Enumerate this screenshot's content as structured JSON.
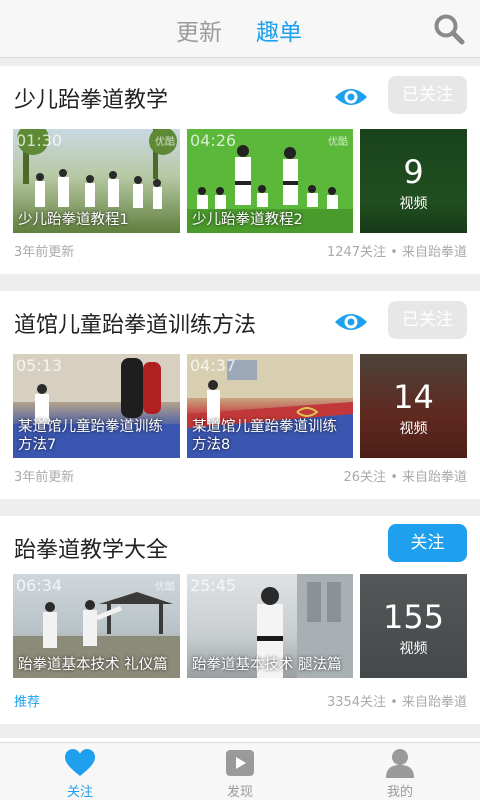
{
  "header": {
    "tabs": [
      {
        "label": "更新"
      },
      {
        "label": "趣单"
      }
    ]
  },
  "colors": {
    "accent": "#1ea0ee",
    "followed_bg": "#e7e7e7",
    "muted_text": "#aaaaaa"
  },
  "lists": [
    {
      "title": "少儿跆拳道教学",
      "button": "已关注",
      "videos": [
        {
          "duration": "01:30",
          "title": "少儿跆拳道教程1",
          "watermark": "优酷"
        },
        {
          "duration": "04:26",
          "title": "少儿跆拳道教程2",
          "watermark": "优酷"
        }
      ],
      "count": "9",
      "count_label": "视频",
      "footer_left": "3年前更新",
      "footer_right": "1247关注 • 来自跆拳道"
    },
    {
      "title": "道馆儿童跆拳道训练方法",
      "button": "已关注",
      "videos": [
        {
          "duration": "05:13",
          "title": "某道馆儿童跆拳道训练方法7",
          "watermark": ""
        },
        {
          "duration": "04:37",
          "title": "某道馆儿童跆拳道训练方法8",
          "watermark": ""
        }
      ],
      "count": "14",
      "count_label": "视频",
      "footer_left": "3年前更新",
      "footer_right": "26关注 • 来自跆拳道"
    },
    {
      "title": "跆拳道教学大全",
      "button": "关注",
      "videos": [
        {
          "duration": "06:34",
          "title": "跆拳道基本技术 礼仪篇",
          "watermark": "优酷"
        },
        {
          "duration": "25:45",
          "title": "跆拳道基本技术 腿法篇",
          "watermark": ""
        }
      ],
      "count": "155",
      "count_label": "视频",
      "footer_left": "推荐",
      "footer_right": "3354关注 • 来自跆拳道"
    }
  ],
  "bottom_nav": [
    {
      "label": "关注",
      "icon": "heart-icon",
      "active": true
    },
    {
      "label": "发现",
      "icon": "play-icon",
      "active": false
    },
    {
      "label": "我的",
      "icon": "person-icon",
      "active": false
    }
  ]
}
